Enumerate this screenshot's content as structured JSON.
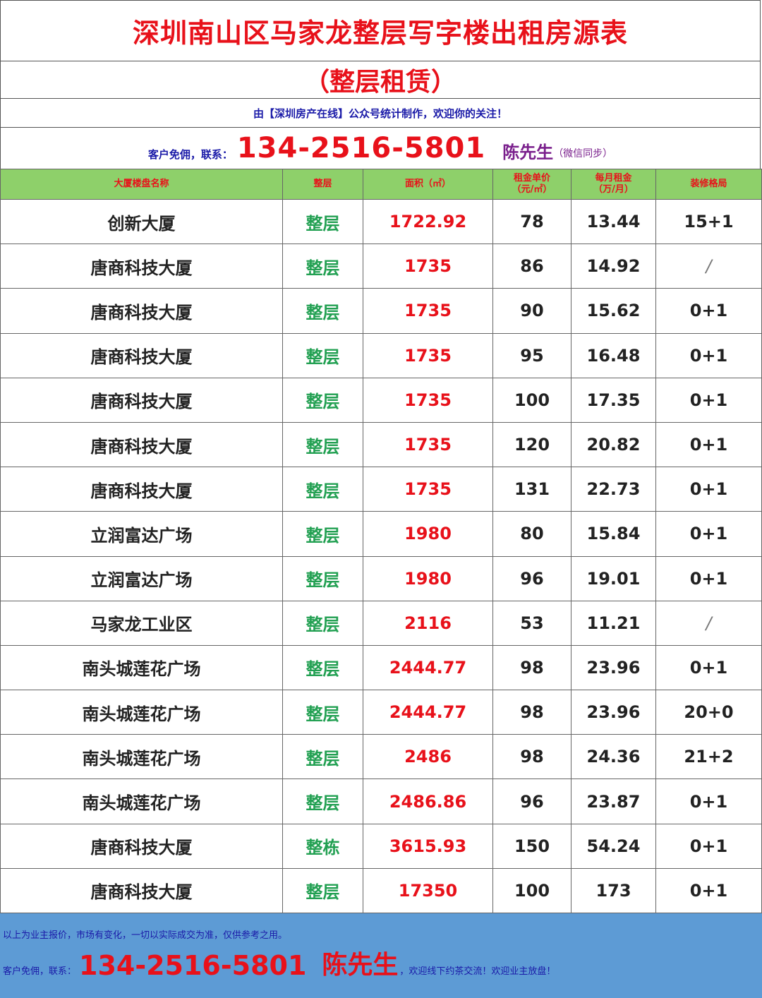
{
  "header": {
    "title": "深圳南山区马家龙整层写字楼出租房源表",
    "subtitle": "（整层租赁）",
    "made_by": "由【深圳房产在线】公众号统计制作，欢迎你的关注！",
    "contact_label": "客户免佣，联系：",
    "phone": "134-2516-5801",
    "contact_name": "陈先生",
    "contact_note": "（微信同步）"
  },
  "table": {
    "columns": [
      "大厦楼盘名称",
      "整层",
      "面积（㎡）",
      "租金单价\n（元/㎡）",
      "每月租金\n（万/月）",
      "装修格局"
    ],
    "rows": [
      [
        "创新大厦",
        "整层",
        "1722.92",
        "78",
        "13.44",
        "15+1"
      ],
      [
        "唐商科技大厦",
        "整层",
        "1735",
        "86",
        "14.92",
        "/"
      ],
      [
        "唐商科技大厦",
        "整层",
        "1735",
        "90",
        "15.62",
        "0+1"
      ],
      [
        "唐商科技大厦",
        "整层",
        "1735",
        "95",
        "16.48",
        "0+1"
      ],
      [
        "唐商科技大厦",
        "整层",
        "1735",
        "100",
        "17.35",
        "0+1"
      ],
      [
        "唐商科技大厦",
        "整层",
        "1735",
        "120",
        "20.82",
        "0+1"
      ],
      [
        "唐商科技大厦",
        "整层",
        "1735",
        "131",
        "22.73",
        "0+1"
      ],
      [
        "立润富达广场",
        "整层",
        "1980",
        "80",
        "15.84",
        "0+1"
      ],
      [
        "立润富达广场",
        "整层",
        "1980",
        "96",
        "19.01",
        "0+1"
      ],
      [
        "马家龙工业区",
        "整层",
        "2116",
        "53",
        "11.21",
        "/"
      ],
      [
        "南头城莲花广场",
        "整层",
        "2444.77",
        "98",
        "23.96",
        "0+1"
      ],
      [
        "南头城莲花广场",
        "整层",
        "2444.77",
        "98",
        "23.96",
        "20+0"
      ],
      [
        "南头城莲花广场",
        "整层",
        "2486",
        "98",
        "24.36",
        "21+2"
      ],
      [
        "南头城莲花广场",
        "整层",
        "2486.86",
        "96",
        "23.87",
        "0+1"
      ],
      [
        "唐商科技大厦",
        "整栋",
        "3615.93",
        "150",
        "54.24",
        "0+1"
      ],
      [
        "唐商科技大厦",
        "整层",
        "17350",
        "100",
        "173",
        "0+1"
      ]
    ]
  },
  "footer": {
    "disclaimer": "以上为业主报价，市场有变化，一切以实际成交为准，仅供参考之用。",
    "contact_label": "客户免佣，联系：",
    "phone": "134-2516-5801",
    "contact_name": "陈先生",
    "tail": "，欢迎线下约茶交流！欢迎业主放盘！"
  },
  "colors": {
    "title_red": "#e8111a",
    "header_green": "#8ed06a",
    "type_green": "#22a052",
    "blue_text": "#1a1aa8",
    "purple_name": "#7a1f8c",
    "footer_blue": "#5d9bd5"
  }
}
